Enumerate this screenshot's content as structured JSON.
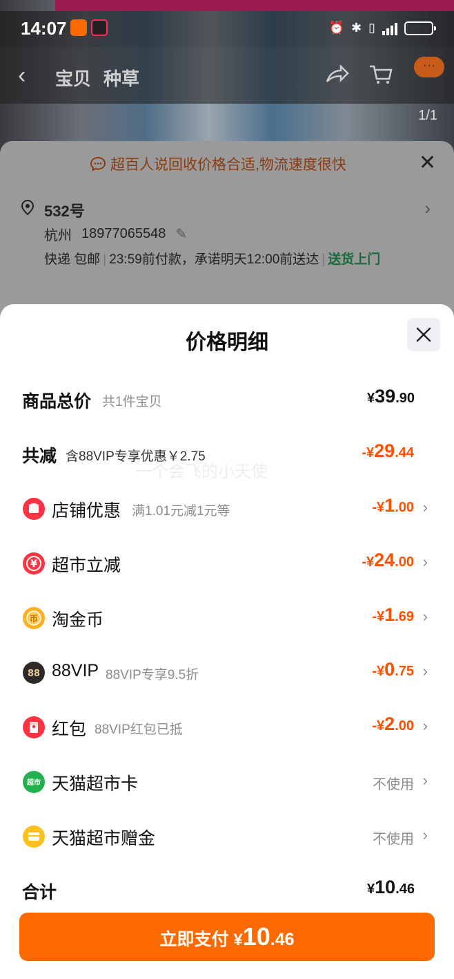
{
  "status_bar": {
    "time": "14:07"
  },
  "nav": {
    "tab1": "宝贝",
    "tab2": "种草",
    "image_counter": "1/1",
    "more_label": "···"
  },
  "tip": {
    "text": "超百人说回收价格合适,物流速度很快"
  },
  "address": {
    "name": "532号",
    "city": "杭州",
    "phone": "18977065548",
    "shipping": "快递 包邮",
    "pay_note": "23:59前付款，承诺明天12:00前送达",
    "door_delivery": "送货上门"
  },
  "sheet": {
    "title": "价格明细",
    "watermark": "一个会飞的小天使",
    "total": {
      "label": "商品总价",
      "sub": "共1件宝贝",
      "currency": "¥",
      "int": "39",
      "dec": ".90"
    },
    "minus": {
      "label": "共减",
      "sub": "含88VIP专享优惠￥2.75",
      "sign": "-",
      "currency": "¥",
      "int": "29",
      "dec": ".44"
    },
    "items": [
      {
        "label": "店铺优惠",
        "sub": "满1.01元减1元等",
        "sign": "-",
        "currency": "¥",
        "int": "1",
        "dec": ".00",
        "icon": "shop-icon",
        "color": "#ff3344"
      },
      {
        "label": "超市立减",
        "sub": "",
        "sign": "-",
        "currency": "¥",
        "int": "24",
        "dec": ".00",
        "icon": "yuan-coin-icon",
        "color": "#ff3344"
      },
      {
        "label": "淘金币",
        "sub": "",
        "sign": "-",
        "currency": "¥",
        "int": "1",
        "dec": ".69",
        "icon": "gold-coin-icon",
        "color": "#ffb020"
      },
      {
        "label": "88VIP",
        "sub": "88VIP专享9.5折",
        "sign": "-",
        "currency": "¥",
        "int": "0",
        "dec": ".75",
        "icon": "vip88-icon",
        "color": "#2e2a28"
      },
      {
        "label": "红包",
        "sub": "88VIP红包已抵",
        "sign": "-",
        "currency": "¥",
        "int": "2",
        "dec": ".00",
        "icon": "red-packet-icon",
        "color": "#ff3344"
      },
      {
        "label": "天猫超市卡",
        "sub": "",
        "note": "不使用",
        "icon": "tmall-supermarket-card-icon",
        "color": "#22b14c"
      },
      {
        "label": "天猫超市赠金",
        "sub": "",
        "note": "不使用",
        "icon": "gift-money-icon",
        "color": "#ffc020"
      }
    ],
    "sum": {
      "label": "合计",
      "currency": "¥",
      "int": "10",
      "dec": ".46"
    },
    "pay_button": {
      "label": "立即支付 ",
      "currency": "¥",
      "int": "10",
      "dec": ".46"
    }
  },
  "colors": {
    "accent": "#ff5000",
    "button": "#ff6a00",
    "green": "#1a6a3c"
  }
}
